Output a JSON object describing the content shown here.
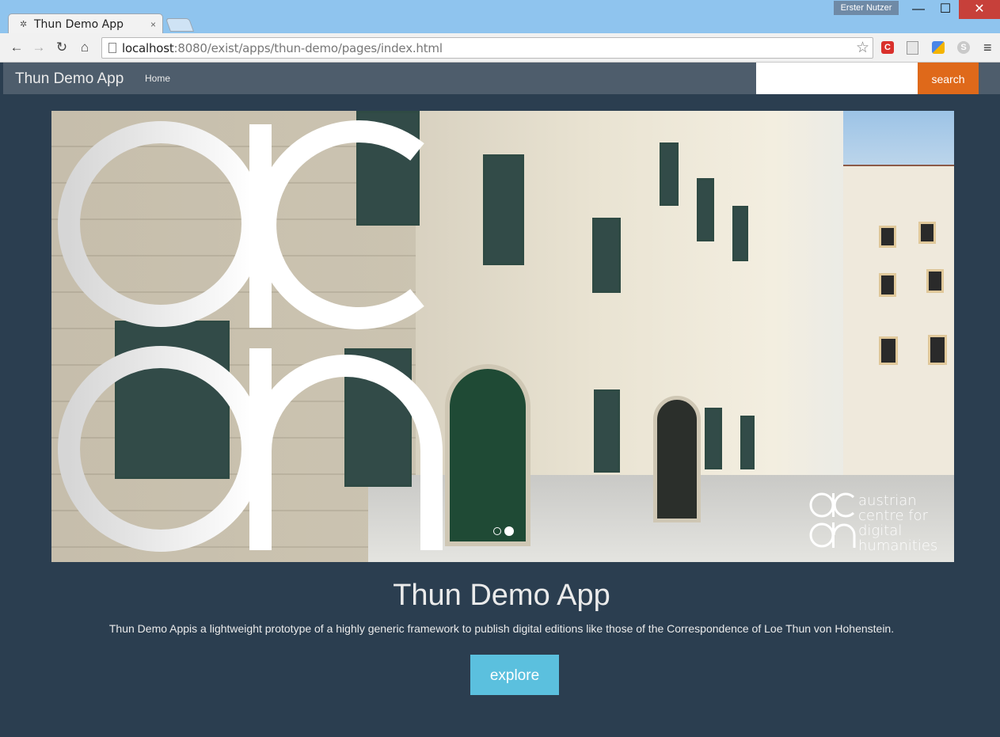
{
  "browser": {
    "tab_title": "Thun Demo App",
    "tab_close": "×",
    "user_badge": "Erster Nutzer",
    "url_host": "localhost",
    "url_rest": ":8080/exist/apps/thun-demo/pages/index.html",
    "window": {
      "minimize": "—",
      "maximize": "☐",
      "close": "✕"
    },
    "nav": {
      "back": "←",
      "forward": "→",
      "reload": "↻",
      "home": "⌂"
    },
    "star": "☆",
    "menu": "≡",
    "extensions": [
      {
        "name": "c-extension-icon",
        "glyph": "C",
        "color": "#d9302b"
      },
      {
        "name": "document-extension-icon",
        "glyph": "",
        "color": "#dcdcdc"
      },
      {
        "name": "translate-extension-icon",
        "glyph": "",
        "color": "#4a86e8"
      },
      {
        "name": "skype-extension-icon",
        "glyph": "S",
        "color": "#c9c9c9"
      }
    ]
  },
  "navbar": {
    "brand": "Thun Demo App",
    "home": "Home",
    "search_placeholder": "",
    "search_button": "search"
  },
  "carousel": {
    "logo_text_lines": [
      "austrian",
      "centre for",
      "digital",
      "humanities"
    ],
    "active_slide": 2,
    "slide_count": 2
  },
  "main": {
    "title": "Thun Demo App",
    "description": "Thun Demo Appis a lightweight prototype of a highly generic framework to publish digital editions like those of the Correspondence of Loe Thun von Hohenstein.",
    "explore_button": "explore"
  },
  "colors": {
    "page_bg": "#2b3e50",
    "navbar_bg": "#4e5d6c",
    "search_button": "#df691a",
    "explore_button": "#5bc0de"
  }
}
